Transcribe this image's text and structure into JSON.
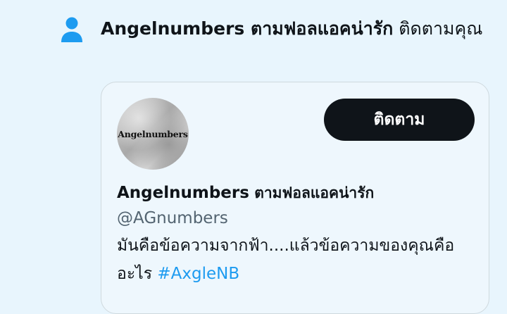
{
  "notification": {
    "icon": "person-icon",
    "icon_color": "#1d9bf0",
    "actor_name": "Angelnumbers ตามฟอลแอคน่ารัก",
    "action_text": "ติดตามคุณ"
  },
  "profile_card": {
    "avatar_logo_text": "Angelnumbers",
    "follow_button_label": "ติดตาม",
    "name_primary": "Angelnumbers",
    "name_secondary": "ตามฟอลแอคน่ารัก",
    "handle": "@AGnumbers",
    "bio_text": "มันคือข้อความจากฟ้า....แล้วข้อความของคุณคืออะไร",
    "bio_hashtag": "#AxgleNB",
    "hashtag_color": "#1d9bf0"
  }
}
